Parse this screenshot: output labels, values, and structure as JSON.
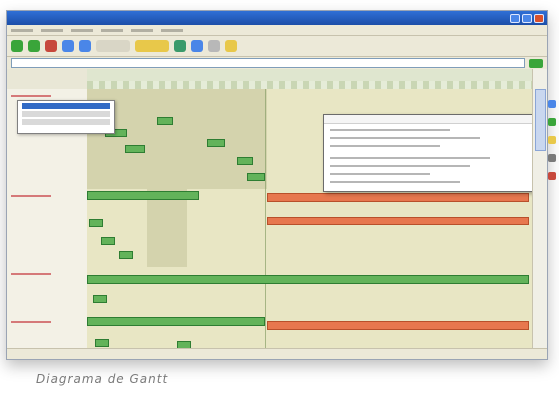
{
  "caption": "Diagrama de Gantt",
  "colors": {
    "bar_green": "#63b35a",
    "bar_orange": "#e7774e",
    "row_bg": "#e8e6c4",
    "titlebar": "#2f6fd6"
  },
  "icons": {
    "window": [
      "minimize-icon",
      "maximize-icon",
      "close-icon"
    ],
    "toolbar": [
      "back-icon",
      "forward-icon",
      "stop-icon",
      "refresh-icon",
      "home-icon",
      "search-icon",
      "favorites-icon",
      "media-icon",
      "history-icon",
      "mail-icon",
      "print-icon"
    ],
    "side": [
      "panel-icon-1",
      "panel-icon-2",
      "panel-icon-3",
      "panel-icon-4",
      "panel-icon-5"
    ]
  }
}
